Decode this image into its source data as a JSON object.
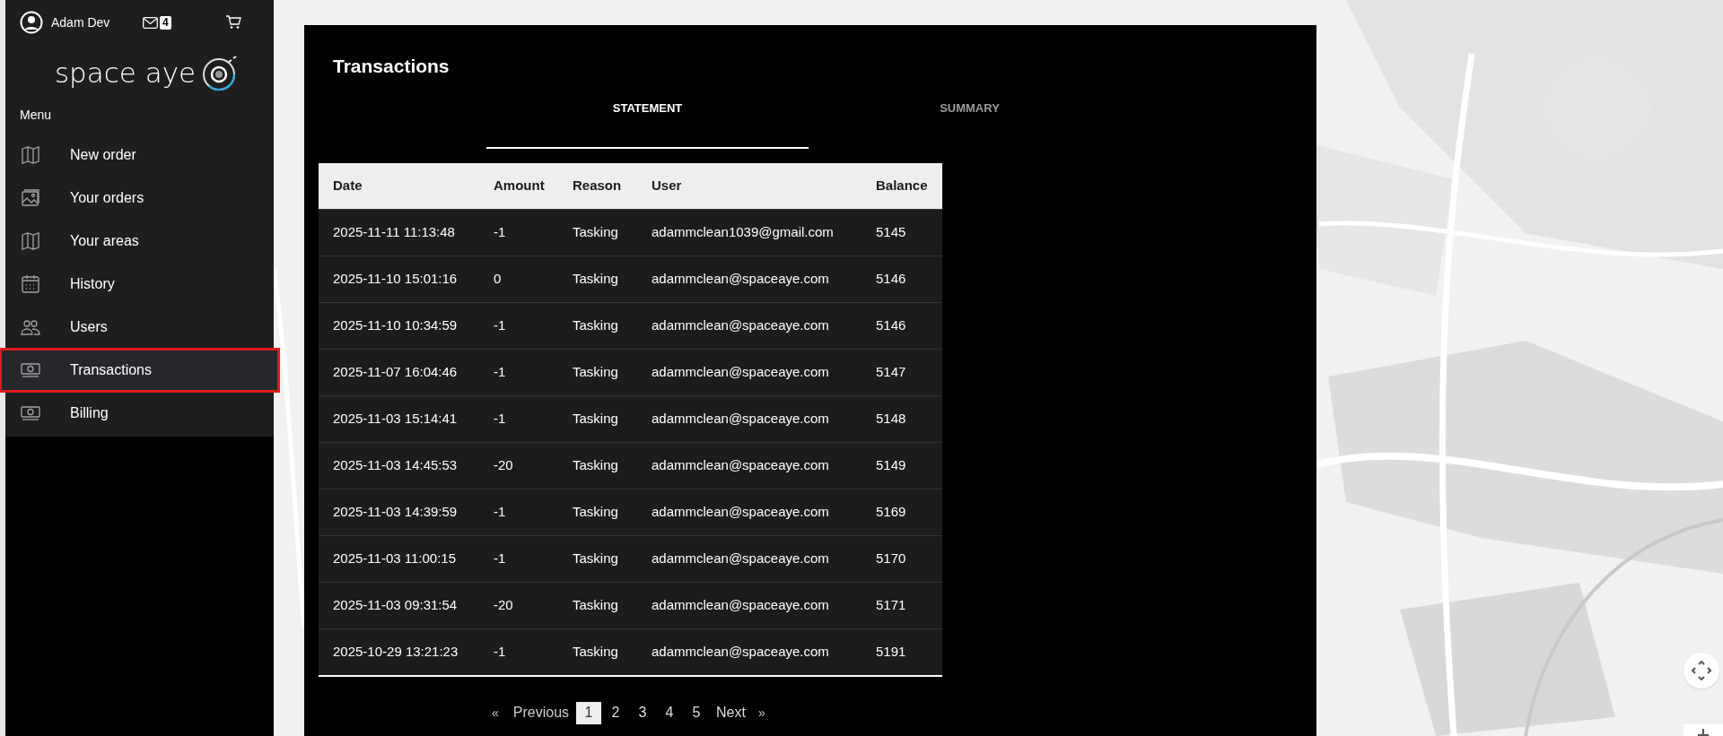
{
  "header": {
    "user_name": "Adam Dev",
    "messages_count": "4"
  },
  "logo": {
    "text": "space aye"
  },
  "menu": {
    "label": "Menu",
    "items": [
      {
        "label": "New order",
        "selected": false
      },
      {
        "label": "Your orders",
        "selected": false
      },
      {
        "label": "Your areas",
        "selected": false
      },
      {
        "label": "History",
        "selected": false
      },
      {
        "label": "Users",
        "selected": false
      },
      {
        "label": "Transactions",
        "selected": true
      },
      {
        "label": "Billing",
        "selected": false
      }
    ]
  },
  "panel": {
    "title": "Transactions",
    "tabs": [
      {
        "label": "STATEMENT",
        "selected": true
      },
      {
        "label": "SUMMARY",
        "selected": false
      }
    ],
    "table": {
      "columns": [
        "Date",
        "Amount",
        "Reason",
        "User",
        "Balance"
      ],
      "rows": [
        [
          "2025-11-11 11:13:48",
          "-1",
          "Tasking",
          "adammclean1039@gmail.com",
          "5145"
        ],
        [
          "2025-11-10 15:01:16",
          "0",
          "Tasking",
          "adammclean@spaceaye.com",
          "5146"
        ],
        [
          "2025-11-10 10:34:59",
          "-1",
          "Tasking",
          "adammclean@spaceaye.com",
          "5146"
        ],
        [
          "2025-11-07 16:04:46",
          "-1",
          "Tasking",
          "adammclean@spaceaye.com",
          "5147"
        ],
        [
          "2025-11-03 15:14:41",
          "-1",
          "Tasking",
          "adammclean@spaceaye.com",
          "5148"
        ],
        [
          "2025-11-03 14:45:53",
          "-20",
          "Tasking",
          "adammclean@spaceaye.com",
          "5149"
        ],
        [
          "2025-11-03 14:39:59",
          "-1",
          "Tasking",
          "adammclean@spaceaye.com",
          "5169"
        ],
        [
          "2025-11-03 11:00:15",
          "-1",
          "Tasking",
          "adammclean@spaceaye.com",
          "5170"
        ],
        [
          "2025-11-03 09:31:54",
          "-20",
          "Tasking",
          "adammclean@spaceaye.com",
          "5171"
        ],
        [
          "2025-10-29 13:21:23",
          "-1",
          "Tasking",
          "adammclean@spaceaye.com",
          "5191"
        ]
      ]
    },
    "pagination": {
      "first": "«",
      "previous": "Previous",
      "pages": [
        {
          "label": "1",
          "selected": true
        },
        {
          "label": "2",
          "selected": false
        },
        {
          "label": "3",
          "selected": false
        },
        {
          "label": "4",
          "selected": false
        },
        {
          "label": "5",
          "selected": false
        }
      ],
      "next": "Next",
      "last": "»"
    }
  }
}
